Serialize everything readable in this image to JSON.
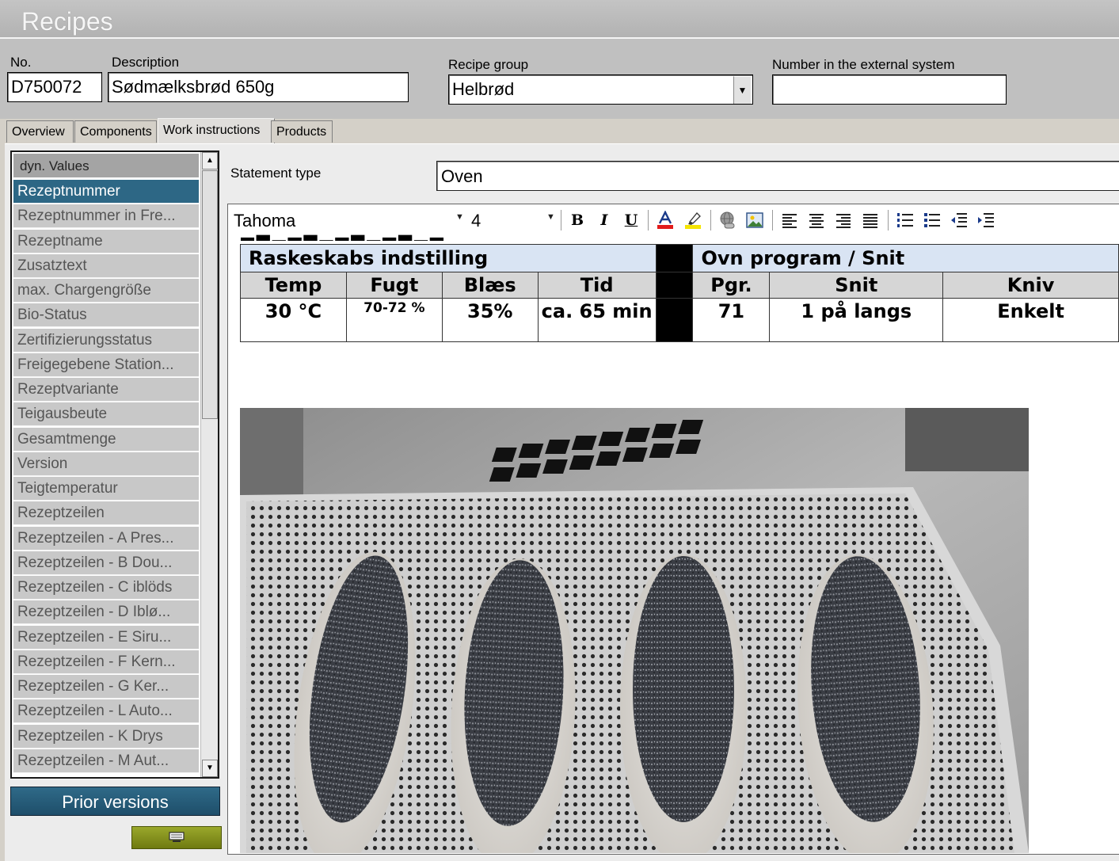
{
  "window": {
    "title": "Recipes"
  },
  "header": {
    "no_label": "No.",
    "no_value": "D750072",
    "description_label": "Description",
    "description_value": "Sødmælksbrød 650g",
    "recipe_group_label": "Recipe group",
    "recipe_group_value": "Helbrød",
    "external_label": "Number in the external system",
    "external_value": ""
  },
  "tabs": [
    {
      "label": "Overview"
    },
    {
      "label": "Components"
    },
    {
      "label": "Work instructions",
      "active": true
    },
    {
      "label": "Products"
    }
  ],
  "sidebar": {
    "header": "dyn. Values",
    "items": [
      "Rezeptnummer",
      "Rezeptnummer in Fre...",
      "Rezeptname",
      "Zusatztext",
      "max. Chargengröße",
      "Bio-Status",
      "Zertifizierungsstatus",
      "Freigegebene Station...",
      "Rezeptvariante",
      "Teigausbeute",
      "Gesamtmenge",
      "Version",
      "Teigtemperatur",
      "Rezeptzeilen",
      "Rezeptzeilen - A Pres...",
      "Rezeptzeilen - B Dou...",
      "Rezeptzeilen - C iblöds",
      "Rezeptzeilen - D Iblø...",
      "Rezeptzeilen - E Siru...",
      "Rezeptzeilen - F Kern...",
      "Rezeptzeilen - G Ker...",
      "Rezeptzeilen - L Auto...",
      "Rezeptzeilen - K Drys",
      "Rezeptzeilen - M Aut..."
    ],
    "selected_index": 0,
    "prior_versions_label": "Prior versions"
  },
  "statement": {
    "label": "Statement type",
    "value": "Oven"
  },
  "editor": {
    "font": "Tahoma",
    "size": "4",
    "toolbar": {
      "bold": "B",
      "italic": "I",
      "underline": "U"
    },
    "table": {
      "group1": "Raskeskabs indstilling",
      "group2": "Ovn program / Snit",
      "columns": [
        "Temp",
        "Fugt",
        "Blæs",
        "Tid",
        "Pgr.",
        "Snit",
        "Kniv"
      ],
      "values": [
        "30 °C",
        "70-72 %",
        "35%",
        "ca. 65 min",
        "71",
        "1 på langs",
        "Enkelt"
      ]
    }
  },
  "colors": {
    "selected": "#2d6785",
    "prior_button": "#2f6a88",
    "table_group_header": "#d9e4f3",
    "table_column_header": "#d6d6d6"
  }
}
